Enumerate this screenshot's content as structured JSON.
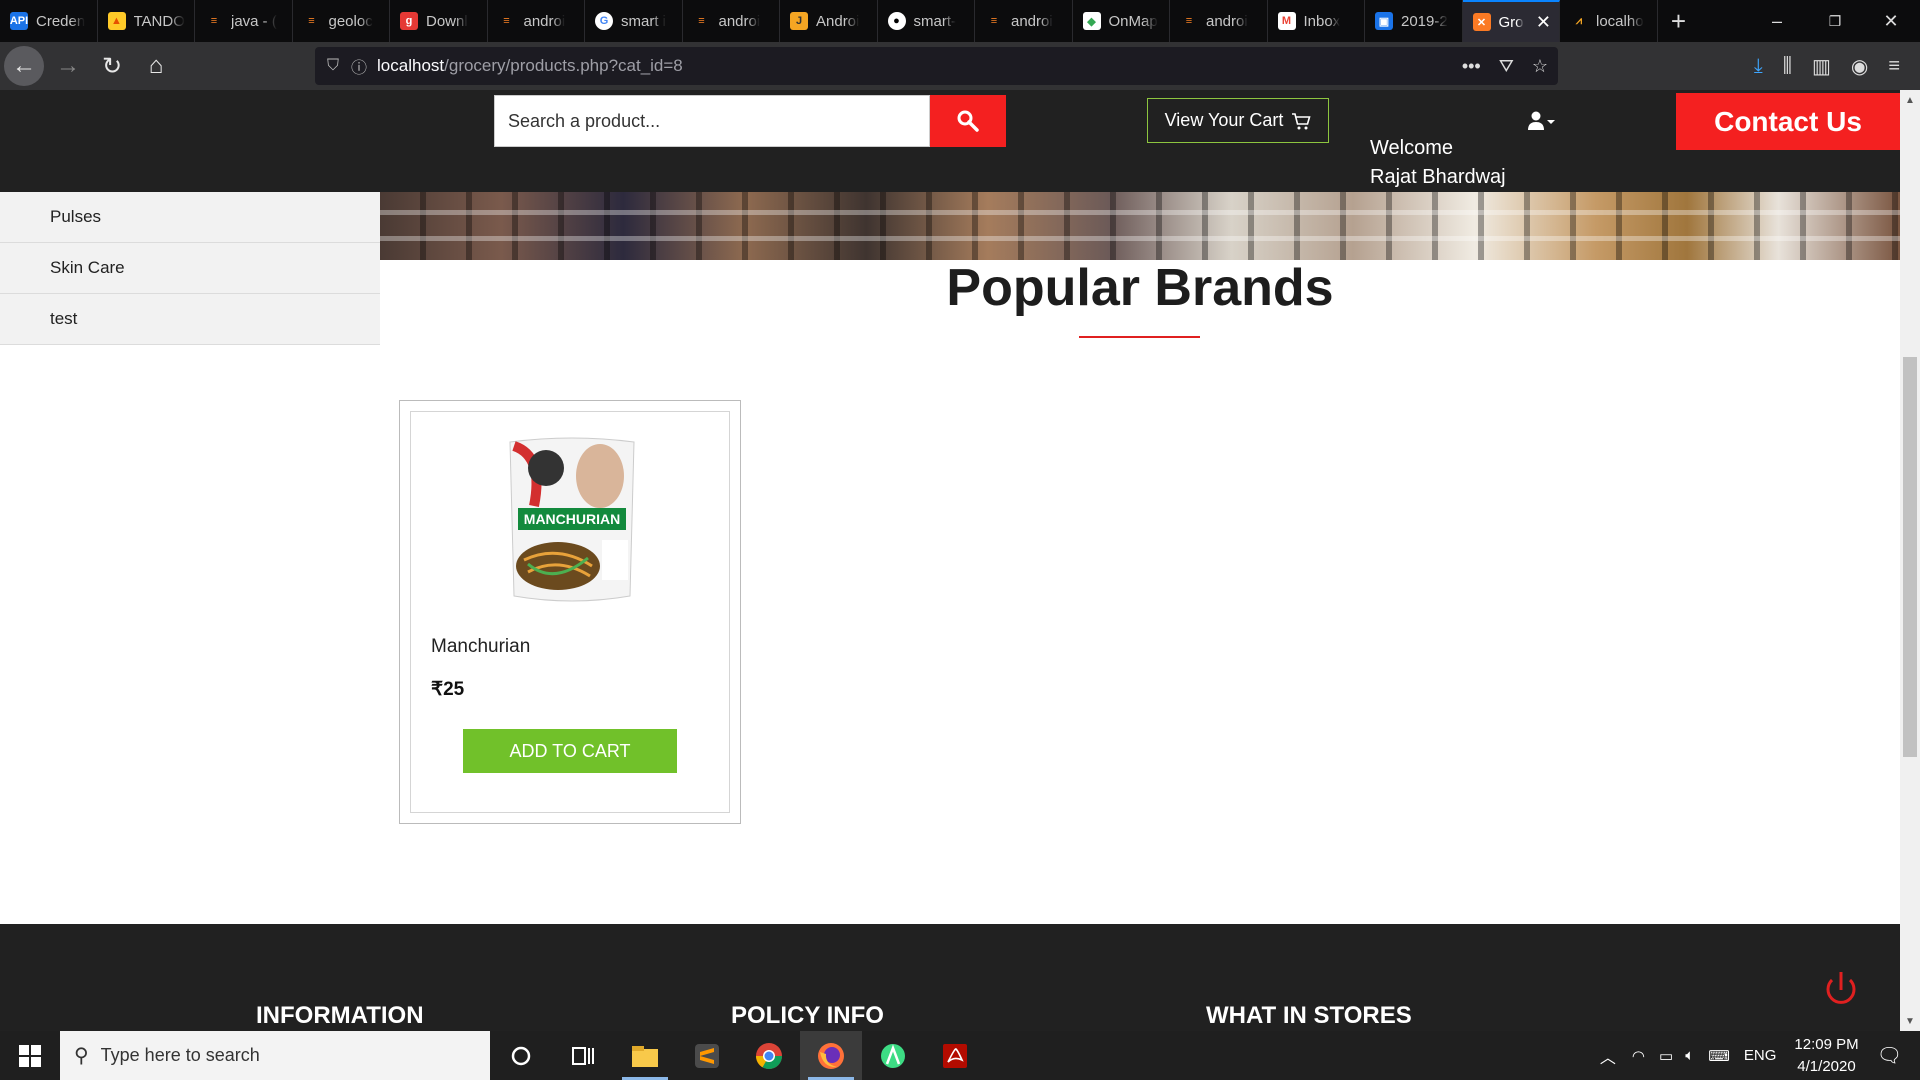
{
  "browser": {
    "tabs": [
      {
        "label": "Creden",
        "icon": "api-icon",
        "color": "#1a73e8"
      },
      {
        "label": "TANDO",
        "icon": "firebase-icon",
        "color": "#ffca28"
      },
      {
        "label": "java - (",
        "icon": "stackoverflow-icon",
        "color": "#f48024"
      },
      {
        "label": "geoloc",
        "icon": "stackoverflow-icon",
        "color": "#f48024"
      },
      {
        "label": "Downl",
        "icon": "download-site-icon",
        "color": "#e53935"
      },
      {
        "label": "androi",
        "icon": "stackoverflow-icon",
        "color": "#f48024"
      },
      {
        "label": "smart i",
        "icon": "google-icon",
        "color": "#4285f4"
      },
      {
        "label": "androi",
        "icon": "stackoverflow-icon",
        "color": "#f48024"
      },
      {
        "label": "Androi",
        "icon": "javatpoint-icon",
        "color": "#f5a623"
      },
      {
        "label": "smart-",
        "icon": "github-icon",
        "color": "#ffffff"
      },
      {
        "label": "androi",
        "icon": "stackoverflow-icon",
        "color": "#f48024"
      },
      {
        "label": "OnMap",
        "icon": "maps-icon",
        "color": "#34a853"
      },
      {
        "label": "androi",
        "icon": "stackoverflow-icon",
        "color": "#f48024"
      },
      {
        "label": "Inbox",
        "icon": "gmail-icon",
        "color": "#ea4335"
      },
      {
        "label": "2019-2",
        "icon": "contacts-icon",
        "color": "#1a73e8"
      },
      {
        "label": "Gro",
        "icon": "xampp-icon",
        "color": "#fb7a24",
        "active": true
      },
      {
        "label": "localho",
        "icon": "localhost-icon",
        "color": "#f5a623"
      }
    ],
    "url_host": "localhost",
    "url_path": "/grocery/products.php?cat_id=8"
  },
  "header": {
    "search_placeholder": "Search a product...",
    "cart_label": "View Your Cart",
    "welcome_line1": "Welcome",
    "welcome_line2": "Rajat Bhardwaj",
    "contact_label": "Contact Us"
  },
  "sidebar": {
    "items": [
      {
        "label": "Pulses"
      },
      {
        "label": "Skin Care"
      },
      {
        "label": "test"
      }
    ]
  },
  "main": {
    "title": "Popular Brands",
    "products": [
      {
        "name": "Manchurian",
        "price": "₹25",
        "button": "ADD TO CART",
        "image_text": "MANCHURIAN"
      }
    ]
  },
  "footer": {
    "headings": [
      "INFORMATION",
      "POLICY INFO",
      "WHAT IN STORES"
    ]
  },
  "taskbar": {
    "search_placeholder": "Type here to search",
    "lang": "ENG",
    "time": "12:09 PM",
    "date": "4/1/2020"
  },
  "colors": {
    "accent_red": "#f42020",
    "cart_green": "#71c12a",
    "header_dark": "#212121"
  }
}
